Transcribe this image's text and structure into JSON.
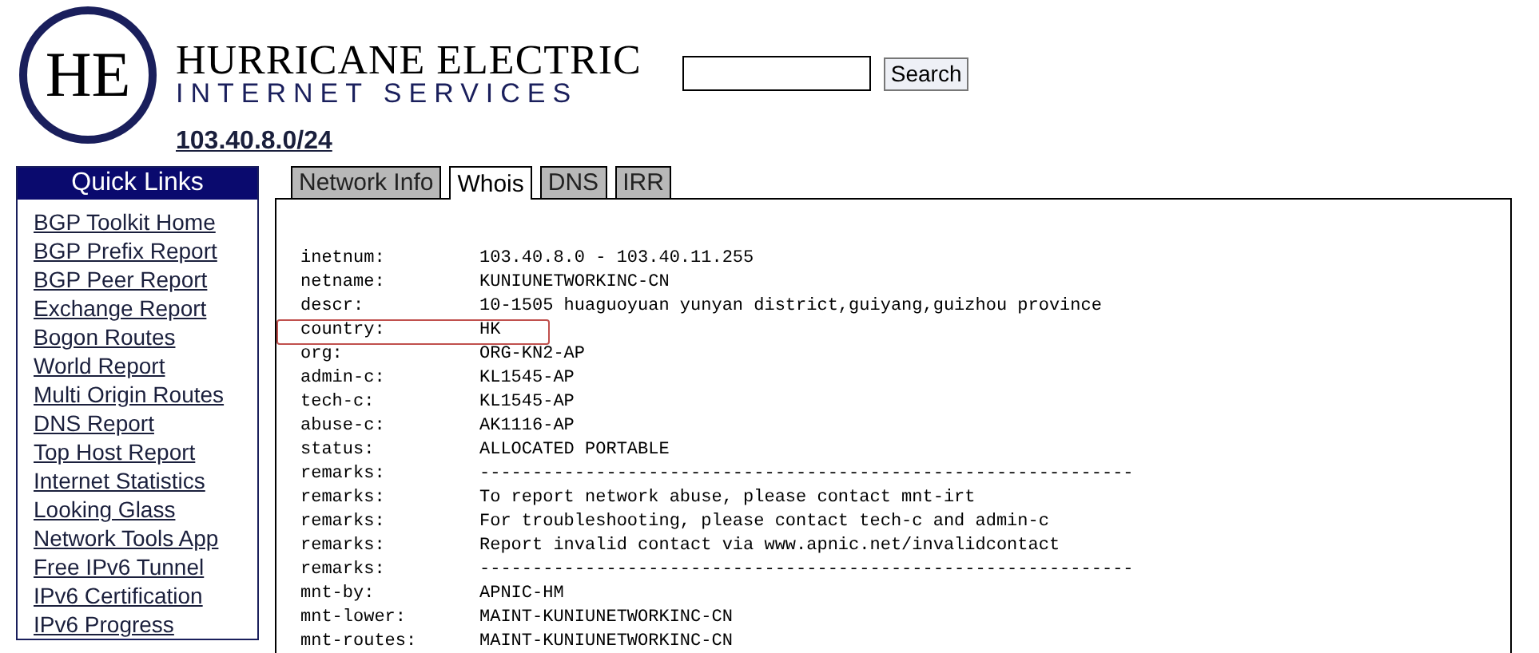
{
  "header": {
    "logo": "HE",
    "title": "HURRICANE ELECTRIC",
    "subtitle": "INTERNET SERVICES",
    "search": {
      "button": "Search"
    },
    "prefix": "103.40.8.0/24"
  },
  "sidebar": {
    "title": "Quick Links",
    "items": [
      "BGP Toolkit Home",
      "BGP Prefix Report",
      "BGP Peer Report",
      "Exchange Report",
      "Bogon Routes",
      "World Report",
      "Multi Origin Routes",
      "DNS Report",
      "Top Host Report",
      "Internet Statistics",
      "Looking Glass",
      "Network Tools App",
      "Free IPv6 Tunnel",
      "IPv6 Certification",
      "IPv6 Progress"
    ]
  },
  "tabs": [
    {
      "label": "Network Info",
      "selected": false
    },
    {
      "label": "Whois",
      "selected": true
    },
    {
      "label": "DNS",
      "selected": false
    },
    {
      "label": "IRR",
      "selected": false
    }
  ],
  "whois": [
    {
      "key": "inetnum:",
      "value": "103.40.8.0 - 103.40.11.255",
      "highlighted": false
    },
    {
      "key": "netname:",
      "value": "KUNIUNETWORKINC-CN",
      "highlighted": false
    },
    {
      "key": "descr:",
      "value": "10-1505 huaguoyuan yunyan district,guiyang,guizhou province",
      "highlighted": false
    },
    {
      "key": "country:",
      "value": "HK",
      "highlighted": true
    },
    {
      "key": "org:",
      "value": "ORG-KN2-AP",
      "highlighted": false
    },
    {
      "key": "admin-c:",
      "value": "KL1545-AP",
      "highlighted": false
    },
    {
      "key": "tech-c:",
      "value": "KL1545-AP",
      "highlighted": false
    },
    {
      "key": "abuse-c:",
      "value": "AK1116-AP",
      "highlighted": false
    },
    {
      "key": "status:",
      "value": "ALLOCATED PORTABLE",
      "highlighted": false
    },
    {
      "key": "remarks:",
      "value": "--------------------------------------------------------------",
      "highlighted": false
    },
    {
      "key": "remarks:",
      "value": "To report network abuse, please contact mnt-irt",
      "highlighted": false
    },
    {
      "key": "remarks:",
      "value": "For troubleshooting, please contact tech-c and admin-c",
      "highlighted": false
    },
    {
      "key": "remarks:",
      "value": "Report invalid contact via www.apnic.net/invalidcontact",
      "highlighted": false
    },
    {
      "key": "remarks:",
      "value": "--------------------------------------------------------------",
      "highlighted": false
    },
    {
      "key": "mnt-by:",
      "value": "APNIC-HM",
      "highlighted": false
    },
    {
      "key": "mnt-lower:",
      "value": "MAINT-KUNIUNETWORKINC-CN",
      "highlighted": false
    },
    {
      "key": "mnt-routes:",
      "value": "MAINT-KUNIUNETWORKINC-CN",
      "highlighted": false
    }
  ]
}
